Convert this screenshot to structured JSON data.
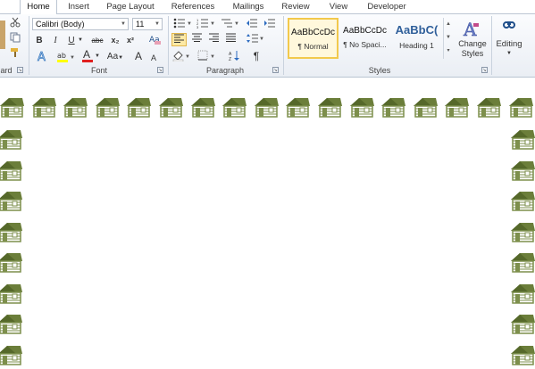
{
  "tabs": [
    "Home",
    "Insert",
    "Page Layout",
    "References",
    "Mailings",
    "Review",
    "View",
    "Developer"
  ],
  "clipboard": {
    "label": "ard"
  },
  "font": {
    "name": "Calibri (Body)",
    "size": "11",
    "label": "Font",
    "buttons": {
      "bold": "B",
      "italic": "I",
      "underline": "U",
      "strike": "abc",
      "subscript": "x₂",
      "superscript": "x²",
      "font_color": "A",
      "change_case": "Aa",
      "grow": "A",
      "shrink": "A"
    }
  },
  "paragraph": {
    "label": "Paragraph",
    "pilcrow": "¶"
  },
  "styles": {
    "label": "Styles",
    "items": [
      {
        "preview": "AaBbCcDc",
        "name": "¶ Normal"
      },
      {
        "preview": "AaBbCcDc",
        "name": "¶ No Spaci..."
      },
      {
        "preview": "AaBbC(",
        "name": "Heading 1"
      }
    ],
    "change_styles_line1": "Change",
    "change_styles_line2": "Styles"
  },
  "editing": {
    "label": "Editing"
  },
  "colors": {
    "house_roof": "#6b7e3a",
    "house_wall": "#7d8f4c",
    "active_tab_border": "#bcc6d3",
    "selected_style": "#f2c94c",
    "font_color_bar": "#e02020",
    "highlight_bar": "#ffff00"
  },
  "icons": [
    "cut-icon",
    "copy-icon",
    "format-painter-icon",
    "bullets-icon",
    "numbering-icon",
    "multilevel-list-icon",
    "decrease-indent-icon",
    "increase-indent-icon",
    "align-left-icon",
    "center-icon",
    "align-right-icon",
    "justify-icon",
    "line-spacing-icon",
    "shading-icon",
    "borders-icon",
    "sort-icon",
    "show-formatting-icon",
    "text-effects-icon",
    "highlight-icon",
    "clear-formatting-icon",
    "change-styles-icon",
    "find-icon",
    "house-icon"
  ]
}
